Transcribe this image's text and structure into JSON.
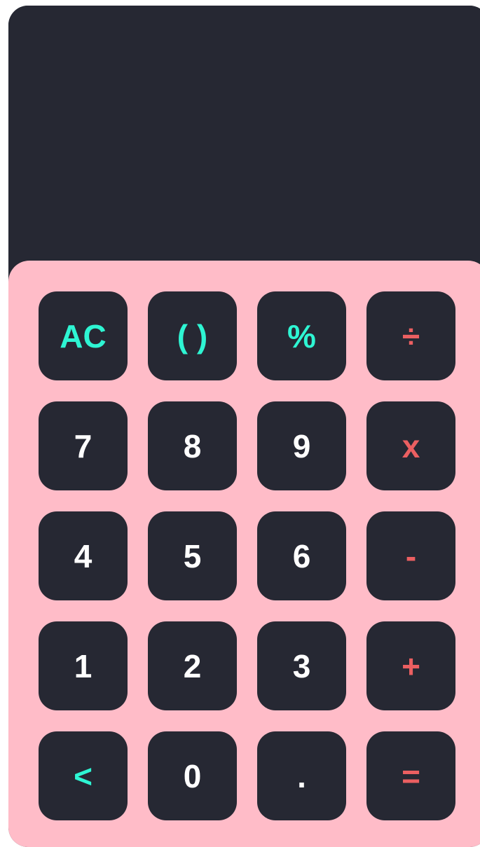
{
  "display": {
    "expression": "",
    "result": ""
  },
  "colors": {
    "body": "#262833",
    "keypad": "#ffbcc8",
    "number_text": "#ffffff",
    "function_text": "#2ef5d3",
    "operator_text": "#eb5f61"
  },
  "keys": [
    {
      "label": "AC",
      "kind": "func",
      "name": "clear-button"
    },
    {
      "label": "( )",
      "kind": "func",
      "name": "parentheses-button"
    },
    {
      "label": "%",
      "kind": "func",
      "name": "percent-button"
    },
    {
      "label": "÷",
      "kind": "op",
      "name": "divide-button"
    },
    {
      "label": "7",
      "kind": "num",
      "name": "digit-7-button"
    },
    {
      "label": "8",
      "kind": "num",
      "name": "digit-8-button"
    },
    {
      "label": "9",
      "kind": "num",
      "name": "digit-9-button"
    },
    {
      "label": "x",
      "kind": "op",
      "name": "multiply-button"
    },
    {
      "label": "4",
      "kind": "num",
      "name": "digit-4-button"
    },
    {
      "label": "5",
      "kind": "num",
      "name": "digit-5-button"
    },
    {
      "label": "6",
      "kind": "num",
      "name": "digit-6-button"
    },
    {
      "label": "-",
      "kind": "op",
      "name": "subtract-button"
    },
    {
      "label": "1",
      "kind": "num",
      "name": "digit-1-button"
    },
    {
      "label": "2",
      "kind": "num",
      "name": "digit-2-button"
    },
    {
      "label": "3",
      "kind": "num",
      "name": "digit-3-button"
    },
    {
      "label": "+",
      "kind": "op",
      "name": "add-button"
    },
    {
      "label": "<",
      "kind": "func",
      "name": "backspace-button"
    },
    {
      "label": "0",
      "kind": "num",
      "name": "digit-0-button"
    },
    {
      "label": ".",
      "kind": "num",
      "name": "decimal-point-button"
    },
    {
      "label": "=",
      "kind": "op",
      "name": "equals-button"
    }
  ]
}
